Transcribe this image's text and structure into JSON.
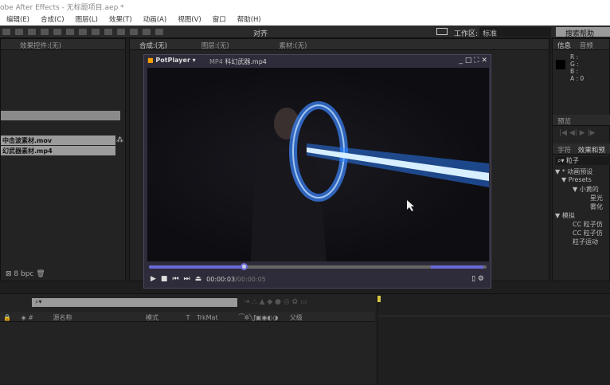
{
  "window": {
    "title": "obe After Effects - 无标题项目.aep *"
  },
  "menu": [
    "编辑(E)",
    "合成(C)",
    "图层(L)",
    "效果(T)",
    "动画(A)",
    "视图(V)",
    "窗口",
    "帮助(H)"
  ],
  "toolbar": {
    "align_label": "对齐",
    "workspace_label": "工作区:",
    "workspace_value": "标准",
    "search_help": "搜索帮助"
  },
  "left_panel": {
    "title": "效果控件:(无)",
    "files": [
      "中击波素材.mov",
      "幻武器素材.mp4"
    ],
    "bpc": "8 bpc"
  },
  "comp_panel": {
    "comp_tab": "合成:(无)",
    "layer_tab": "图层:(无)",
    "footage_tab": "素材:(无)"
  },
  "player": {
    "app": "PotPlayer",
    "format": "MP4",
    "filename": "科幻武器.mp4",
    "current_time": "00:00:03",
    "duration": "00:00:05",
    "progress": 0.28,
    "volume": 1.0
  },
  "info_panel": {
    "tab_info": "信息",
    "tab_audio": "音频",
    "r": "R :",
    "g": "G :",
    "b": "B :",
    "a": "A : 0"
  },
  "preview_panel": {
    "tab": "预览"
  },
  "effects_panel": {
    "tab_char": "字符",
    "tab_effects": "效果和预",
    "search": "粒子",
    "tree": [
      "▼ * 动画预设",
      "▼ Presets",
      "▼ 小黄的",
      "星光",
      "雾化",
      "▼ 模拟",
      "CC 粒子仿",
      "CC 粒子仿",
      "粒子运动"
    ]
  },
  "timeline": {
    "columns": {
      "layer_name": "源名称",
      "mode": "模式",
      "t": "T",
      "trkmat": "TrkMat",
      "parent": "父级"
    }
  }
}
